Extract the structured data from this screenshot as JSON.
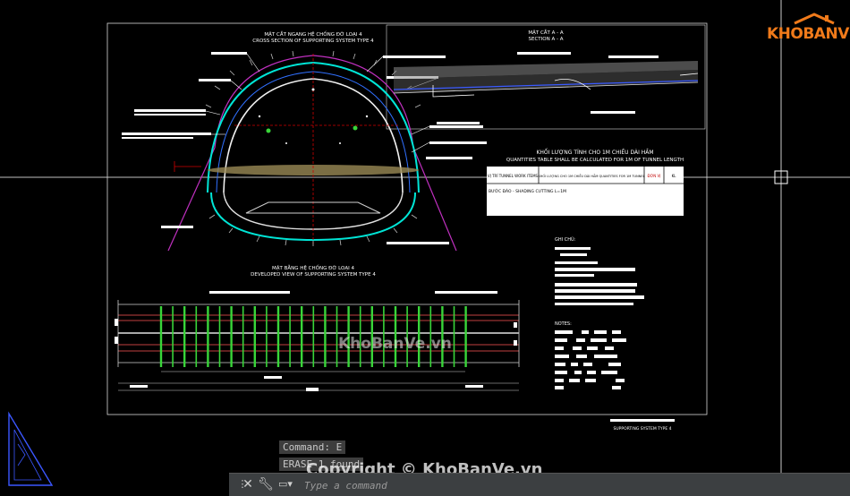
{
  "drawing": {
    "cross_section": {
      "title_vn": "MẶT CẮT NGANG HỆ CHỐNG ĐỠ LOẠI 4",
      "title_en": "CROSS SECTION OF SUPPORTING SYSTEM TYPE 4"
    },
    "section_aa": {
      "title_vn": "MẶT CẮT A - A",
      "title_en": "SECTION A - A"
    },
    "quantities": {
      "title_vn": "KHỐI LƯỢNG TÍNH CHO 1M CHIỀU DÀI HẦM",
      "title_en": "QUANTITIES TABLE SHALL BE CALCULATED FOR 1M OF TUNNEL LENGTH",
      "header_col1": "VỊ TRÍ  TUNNEL WORK ITEMS",
      "header_col2": "KHỐI LƯỢNG CHO 1M CHIỀU DÀI HẦM  QUANTITIES FOR 1M TUNNEL",
      "header_col3": "ĐƠN VỊ",
      "header_col4": "KL",
      "row1": "BƯỚC ĐÀO - SHADING CUTTING L=1M"
    },
    "notes": {
      "ghi_chu": "GHI CHÚ:",
      "notes_en": "NOTES:"
    },
    "developed_view": {
      "title_vn": "MẶT BẰNG HỆ CHỐNG ĐỠ LOẠI 4",
      "title_en": "DEVELOPED VIEW OF SUPPORTING SYSTEM TYPE 4"
    },
    "sheet_label": "SUPPORTING SYSTEM TYPE 4"
  },
  "command_history": [
    "Command: E",
    "ERASE 1 found"
  ],
  "command_line": {
    "placeholder": "Type a command"
  },
  "branding": {
    "logo_text": "KHOBANVE",
    "watermark_center": "KhoBanVe.vn",
    "watermark_bottom": "Copyright © KhoBanVe.vn"
  },
  "colors": {
    "background": "#000000",
    "tunnel_outline": "#00e5d6",
    "support_arch": "#d020d0",
    "green_ribs": "#39d539",
    "logo_orange": "#f07a1a"
  }
}
